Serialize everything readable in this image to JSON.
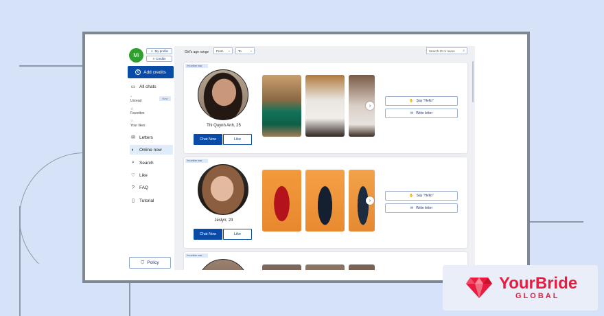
{
  "sidebar": {
    "avatar_initials": "Mi",
    "my_profile": "My profile",
    "credits": "Credits",
    "add_credits": "Add credits",
    "all_chats": "All chats",
    "unread": "Unread",
    "new_badge": "New",
    "favorites": "Favorites",
    "your_likes": "Your likes",
    "letters": "Letters",
    "online_now": "Online now",
    "search": "Search",
    "like": "Like",
    "faq": "FAQ",
    "tutorial": "Tutorial",
    "policy": "Policy"
  },
  "filters": {
    "label": "Girl's age range",
    "from": "From",
    "to": "To",
    "search_placeholder": "Search ID or name"
  },
  "cards": [
    {
      "tag": "I'm online now",
      "name": "Thi Quynh Anh, 25",
      "chat": "Chat Now",
      "like": "Like",
      "hello": "Say \"Hello\"",
      "letter": "Write letter"
    },
    {
      "tag": "I'm online now",
      "name": "Jeslyn, 23",
      "chat": "Chat Now",
      "like": "Like",
      "hello": "Say \"Hello\"",
      "letter": "Write letter"
    },
    {
      "tag": "I'm online now"
    }
  ],
  "brand": {
    "name": "YourBride",
    "sub": "GLOBAL",
    "color": "#e81c3f"
  },
  "colors": {
    "primary": "#0a4ba8",
    "background": "#d5e2f8"
  }
}
